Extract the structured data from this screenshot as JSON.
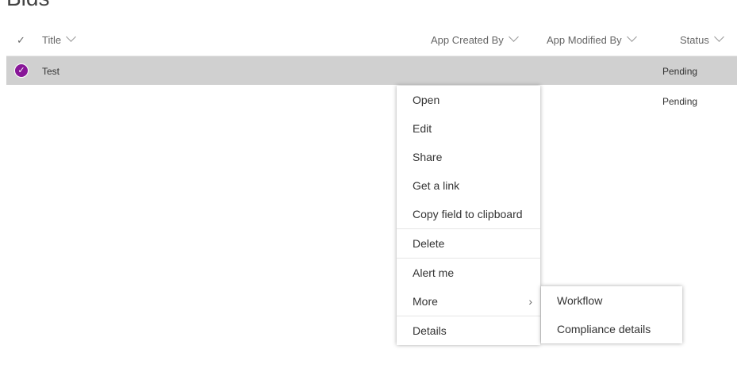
{
  "page_title": "Bids",
  "columns": {
    "title": "Title",
    "created_by": "App Created By",
    "modified_by": "App Modified By",
    "status": "Status"
  },
  "rows": [
    {
      "title": "Test",
      "status": "Pending",
      "selected": true
    },
    {
      "title": "",
      "status": "Pending",
      "selected": false
    }
  ],
  "context_menu": [
    "Open",
    "Edit",
    "Share",
    "Get a link",
    "Copy field to clipboard",
    "Delete",
    "Alert me",
    "More",
    "Details"
  ],
  "submenu": [
    "Workflow",
    "Compliance details"
  ]
}
